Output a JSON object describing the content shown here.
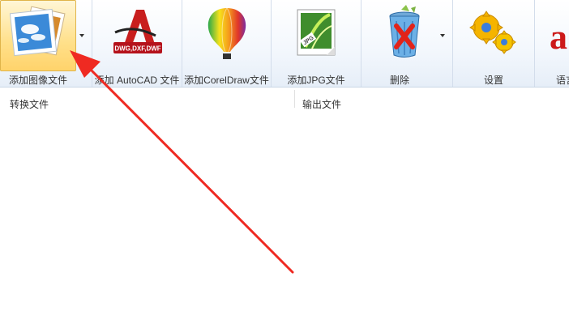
{
  "toolbar": {
    "buttons": [
      {
        "label": "添加图像文件",
        "icon": "photo-stack-icon"
      },
      {
        "label": "添加 AutoCAD 文件",
        "icon": "autocad-icon",
        "badge": "DWG,DXF,DWF"
      },
      {
        "label": "添加CorelDraw文件",
        "icon": "coreldraw-balloon-icon"
      },
      {
        "label": "添加JPG文件",
        "icon": "jpg-file-icon",
        "badge": "JPG"
      },
      {
        "label": "删除",
        "icon": "recycle-bin-icon"
      },
      {
        "label": "设置",
        "icon": "gears-icon"
      },
      {
        "label": "语言",
        "icon": "language-icon"
      }
    ]
  },
  "panels": {
    "convert_title": "转换文件",
    "output_title": "输出文件"
  },
  "colors": {
    "highlight": "#ffe08a",
    "arrow": "#ef2a22",
    "toolbar_bg": "#eef4fb"
  }
}
